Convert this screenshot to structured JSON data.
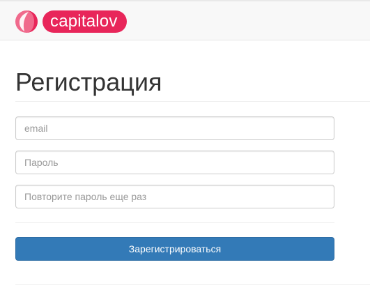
{
  "brand": {
    "name": "capitalov",
    "logo_icon": "capitalov-logo-icon",
    "accent_color": "#e8265a"
  },
  "page": {
    "title": "Регистрация"
  },
  "form": {
    "email_placeholder": "email",
    "password_placeholder": "Пароль",
    "password_repeat_placeholder": "Повторите пароль еще раз",
    "submit_label": "Зарегистрироваться",
    "submit_color": "#337ab7"
  }
}
